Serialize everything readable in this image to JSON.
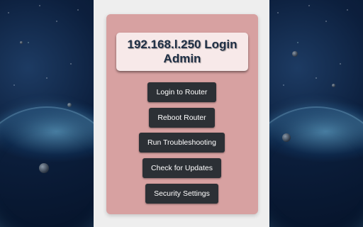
{
  "background": {
    "theme": "space-planet-illustration"
  },
  "card": {
    "title": "192.168.l.250 Login Admin",
    "background_color": "#d7a1a1",
    "title_box_color": "#f7e9e9"
  },
  "buttons": {
    "login": "Login to Router",
    "reboot": "Reboot Router",
    "troubleshoot": "Run Troubleshooting",
    "updates": "Check for Updates",
    "security": "Security Settings"
  },
  "colors": {
    "button_bg": "#2c3035",
    "button_text": "#ffffff",
    "title_text": "#1f2f45",
    "page_center": "#eeeeee"
  }
}
